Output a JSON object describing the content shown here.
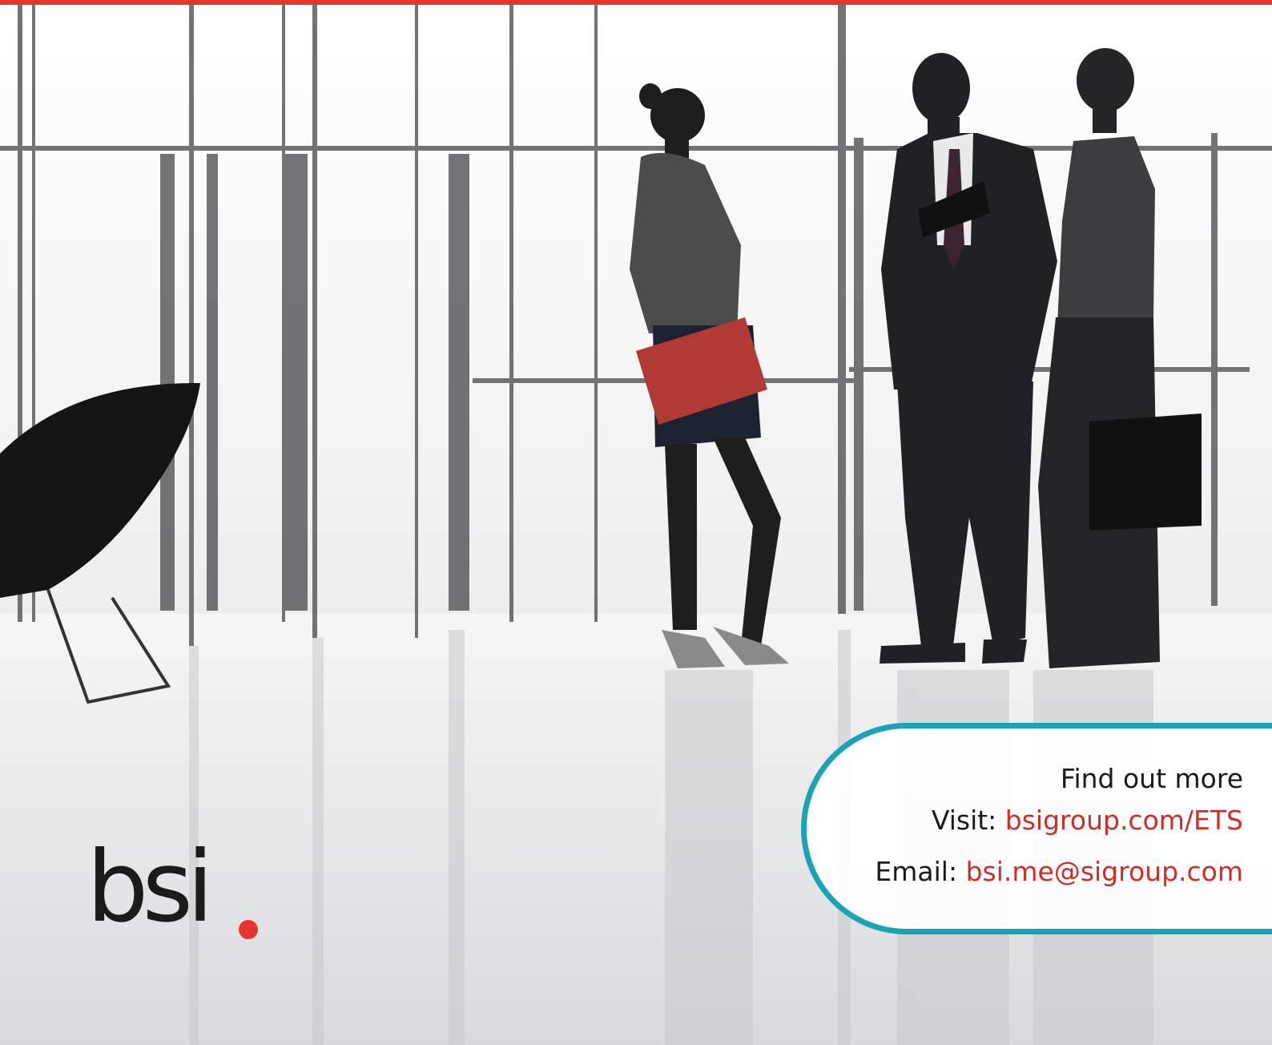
{
  "brand": {
    "logo_text": "bsi",
    "accent": "#e8352c",
    "teal": "#1aa3b8"
  },
  "contact": {
    "heading": "Find out more",
    "visit_label": "Visit:",
    "visit_link": "bsigroup.com/ETS",
    "email_label": "Email:",
    "email_link": "bsi.me@sigroup.com"
  }
}
